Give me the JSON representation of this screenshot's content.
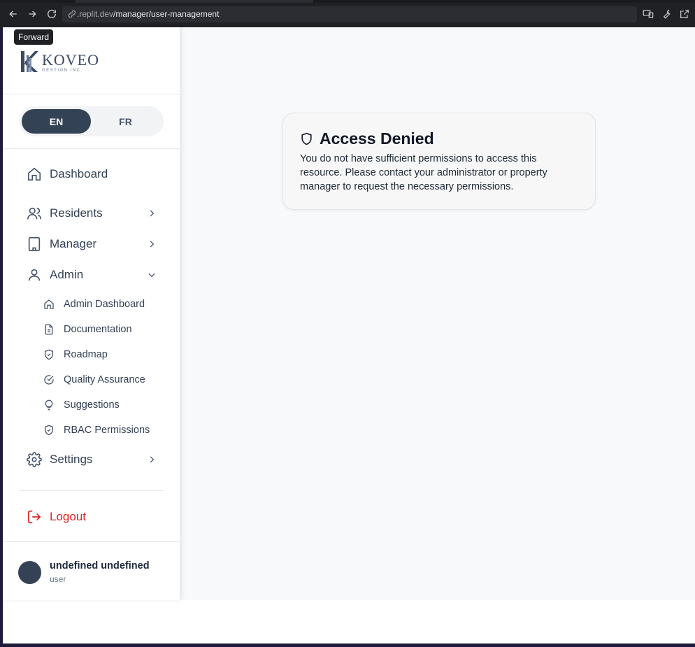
{
  "browser": {
    "tooltip": "Forward",
    "url_host": ".replit.dev",
    "url_path": "/manager/user-management"
  },
  "logo": {
    "name": "KOVEO",
    "subtitle": "GESTION INC."
  },
  "language": {
    "en": "EN",
    "fr": "FR",
    "selected": "EN"
  },
  "nav": {
    "dashboard": "Dashboard",
    "residents": "Residents",
    "manager": "Manager",
    "admin": "Admin",
    "settings": "Settings",
    "logout": "Logout"
  },
  "admin_submenu": [
    {
      "label": "Admin Dashboard",
      "icon": "home-icon"
    },
    {
      "label": "Documentation",
      "icon": "document-icon"
    },
    {
      "label": "Roadmap",
      "icon": "shield-check-icon"
    },
    {
      "label": "Quality Assurance",
      "icon": "check-circle-icon"
    },
    {
      "label": "Suggestions",
      "icon": "lightbulb-icon"
    },
    {
      "label": "RBAC Permissions",
      "icon": "shield-check-icon"
    }
  ],
  "user": {
    "name": "undefined undefined",
    "role": "user"
  },
  "access": {
    "title": "Access Denied",
    "message": "You do not have sufficient permissions to access this resource. Please contact your administrator or property manager to request the necessary permissions."
  },
  "colors": {
    "accent": "#344256",
    "danger": "#dc2626",
    "text": "#334155"
  }
}
